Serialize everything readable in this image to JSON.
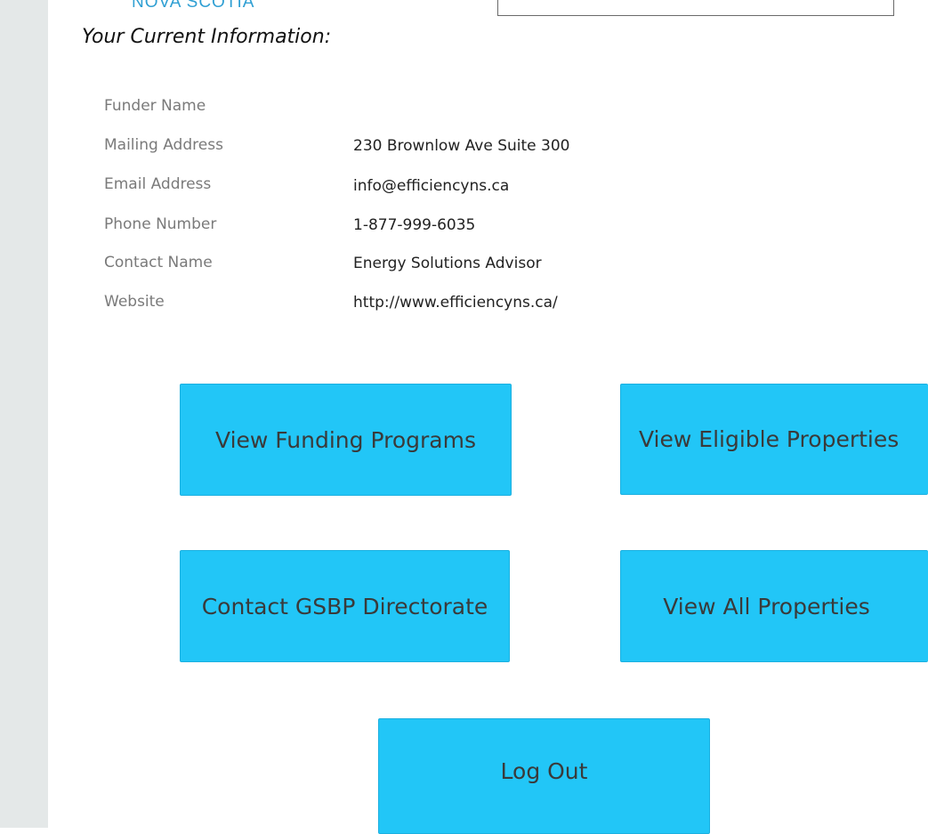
{
  "header": {
    "logo_text": "NOVA SCOTIA"
  },
  "section": {
    "title": "Your Current Information:"
  },
  "info": {
    "funder_name": {
      "label": "Funder Name",
      "value": ""
    },
    "mailing_address": {
      "label": "Mailing Address",
      "value": "230 Brownlow Ave Suite 300"
    },
    "email_address": {
      "label": "Email Address",
      "value": "info@efficiencyns.ca"
    },
    "phone_number": {
      "label": "Phone Number",
      "value": "1-877-999-6035"
    },
    "contact_name": {
      "label": "Contact Name",
      "value": "Energy Solutions Advisor"
    },
    "website": {
      "label": "Website",
      "value": "http://www.efficiencyns.ca/"
    }
  },
  "actions": {
    "view_funding_programs": "View Funding Programs",
    "view_eligible_properties": "View Eligible Properties",
    "contact_gsbp_directorate": "Contact GSBP Directorate",
    "view_all_properties": "View All Properties",
    "log_out": "Log Out"
  },
  "colors": {
    "button_background": "#22c6f7",
    "logo_text": "#2f9fd3",
    "sidebar_background": "#e4e8e8"
  }
}
